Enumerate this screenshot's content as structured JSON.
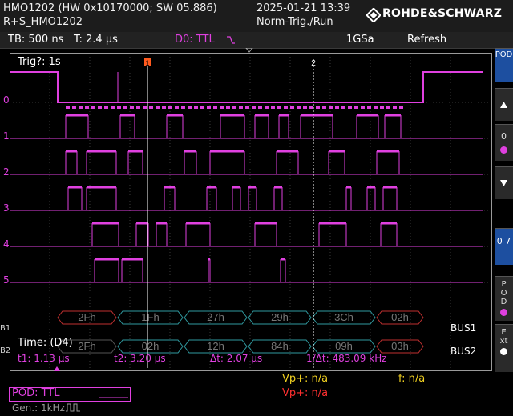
{
  "header": {
    "device_line": "HMO1202 (HW 0x10170000; SW 05.886)",
    "device_name": "R+S_HMO1202",
    "datetime": "2025-01-21 13:39",
    "trigger_mode": "Norm-Trig./Run",
    "brand": "ROHDE&SCHWARZ"
  },
  "status_bar": {
    "timebase": "TB: 500 ns",
    "trigger_time": "T: 2.4 µs",
    "trigger_source": "D0: TTL",
    "sample_rate": "1GSa",
    "acq_mode": "Refresh"
  },
  "screen": {
    "trig_info": "Trig?: 1s",
    "channel_labels": [
      "0",
      "1",
      "2",
      "3",
      "4",
      "5"
    ],
    "bus_labels": [
      "B1",
      "B2"
    ],
    "cursor_labels": [
      "1",
      "2"
    ],
    "time_label": "Time: (D4)",
    "bus1": {
      "name": "BUS1",
      "values": [
        "2Fh",
        "1Fh",
        "27h",
        "29h",
        "3Ch",
        "02h"
      ]
    },
    "bus2": {
      "name": "BUS2",
      "values": [
        "2Fh",
        "02h",
        "12h",
        "84h",
        "09h",
        "03h"
      ]
    }
  },
  "measurements": {
    "t1": "t1: 1.13 µs",
    "t2": "t2: 3.20 µs",
    "dt": "Δt: 2.07 µs",
    "freq": "1/Δt: 483.09 kHz"
  },
  "sidebar": {
    "pod_top": "POD",
    "ch_index": "0",
    "range": "0 7",
    "pod_bottom": "POD",
    "ext": "Ext"
  },
  "bottom": {
    "pod_setting": "POD: TTL",
    "generator": "Gen.: 1kHz",
    "vp1": "Vp+: n/a",
    "vp2": "Vp+: n/a",
    "freq_counter": "f: n/a"
  },
  "colors": {
    "digital": "#e040e0",
    "bus_box_red": "#c03030",
    "bus_box_teal": "#309aa0",
    "cursor": "#ffffff",
    "trigger_marker": "#ff5a1e",
    "accent_blue": "#1d4fa0"
  }
}
